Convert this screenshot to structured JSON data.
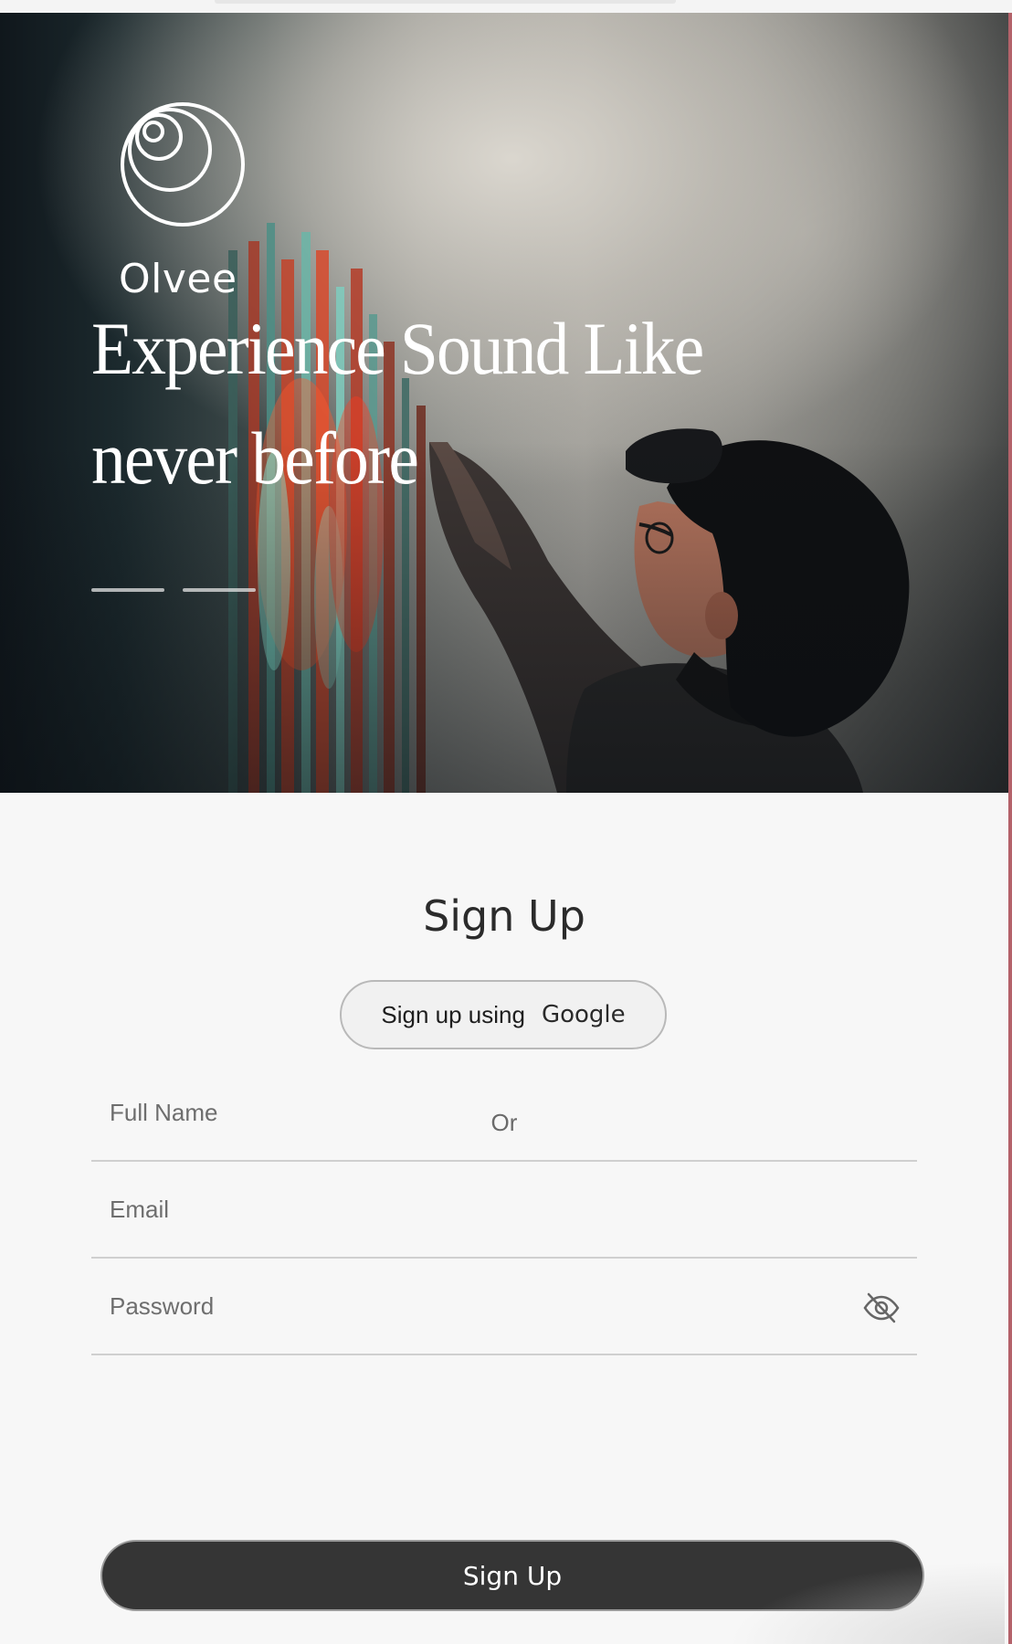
{
  "brand": {
    "name": "Olvee",
    "logo_icon": "concentric-circles-logo"
  },
  "hero": {
    "headline_line1": "Experience Sound Like",
    "headline_line2": "never before",
    "carousel": {
      "slides": 2
    }
  },
  "form": {
    "title": "Sign Up",
    "google_button": {
      "label": "Sign up using",
      "provider": "Google"
    },
    "divider": "Or",
    "fields": {
      "full_name": {
        "placeholder": "Full Name",
        "value": ""
      },
      "email": {
        "placeholder": "Email",
        "value": ""
      },
      "password": {
        "placeholder": "Password",
        "value": "",
        "toggle_icon": "eye-slash-icon"
      }
    },
    "submit_label": "Sign Up"
  },
  "colors": {
    "form_background": "#f7f7f7",
    "submit_background": "#353535",
    "title_text": "#2b2b2b",
    "window_edge": "#b4626a"
  }
}
